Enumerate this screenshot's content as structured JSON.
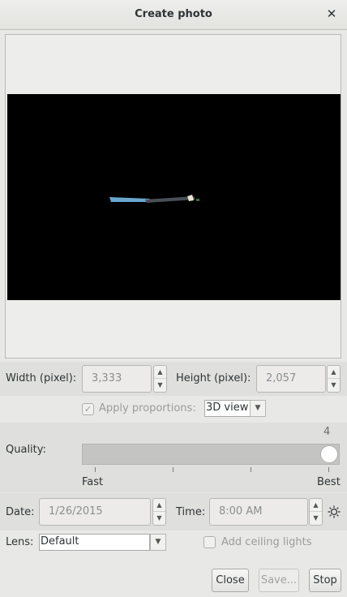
{
  "window": {
    "title": "Create photo",
    "close_glyph": "✕"
  },
  "size": {
    "width_label": "Width (pixel):",
    "width_value": "3,333",
    "height_label": "Height (pixel):",
    "height_value": "2,057"
  },
  "proportions": {
    "checked": true,
    "label": "Apply proportions:",
    "view_value": "3D view"
  },
  "quality": {
    "label": "Quality:",
    "value": "4",
    "level_fraction": 1.0,
    "min_label": "Fast",
    "max_label": "Best"
  },
  "date": {
    "label": "Date:",
    "value": "1/26/2015"
  },
  "time": {
    "label": "Time:",
    "value": "8:00 AM"
  },
  "lens": {
    "label": "Lens:",
    "value": "Default"
  },
  "ceiling_lights": {
    "checked": false,
    "label": "Add ceiling lights"
  },
  "buttons": {
    "close": "Close",
    "save": "Save...",
    "stop": "Stop"
  },
  "icons": {
    "sun": "sun-icon",
    "spin_up": "▲",
    "spin_down": "▼",
    "dropdown": "▼",
    "check": "✓"
  },
  "colors": {
    "preview_bg": "#000000",
    "band": "#dfdfdd"
  }
}
